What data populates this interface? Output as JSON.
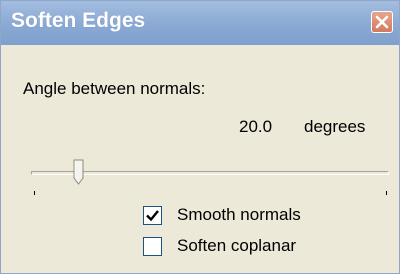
{
  "window": {
    "title": "Soften Edges",
    "close_icon": "close-icon"
  },
  "angle": {
    "label": "Angle between normals:",
    "value": "20.0",
    "units": "degrees"
  },
  "slider": {
    "level_fraction": 0.13
  },
  "options": [
    {
      "label": "Smooth normals",
      "checked": true
    },
    {
      "label": "Soften coplanar",
      "checked": false
    }
  ]
}
